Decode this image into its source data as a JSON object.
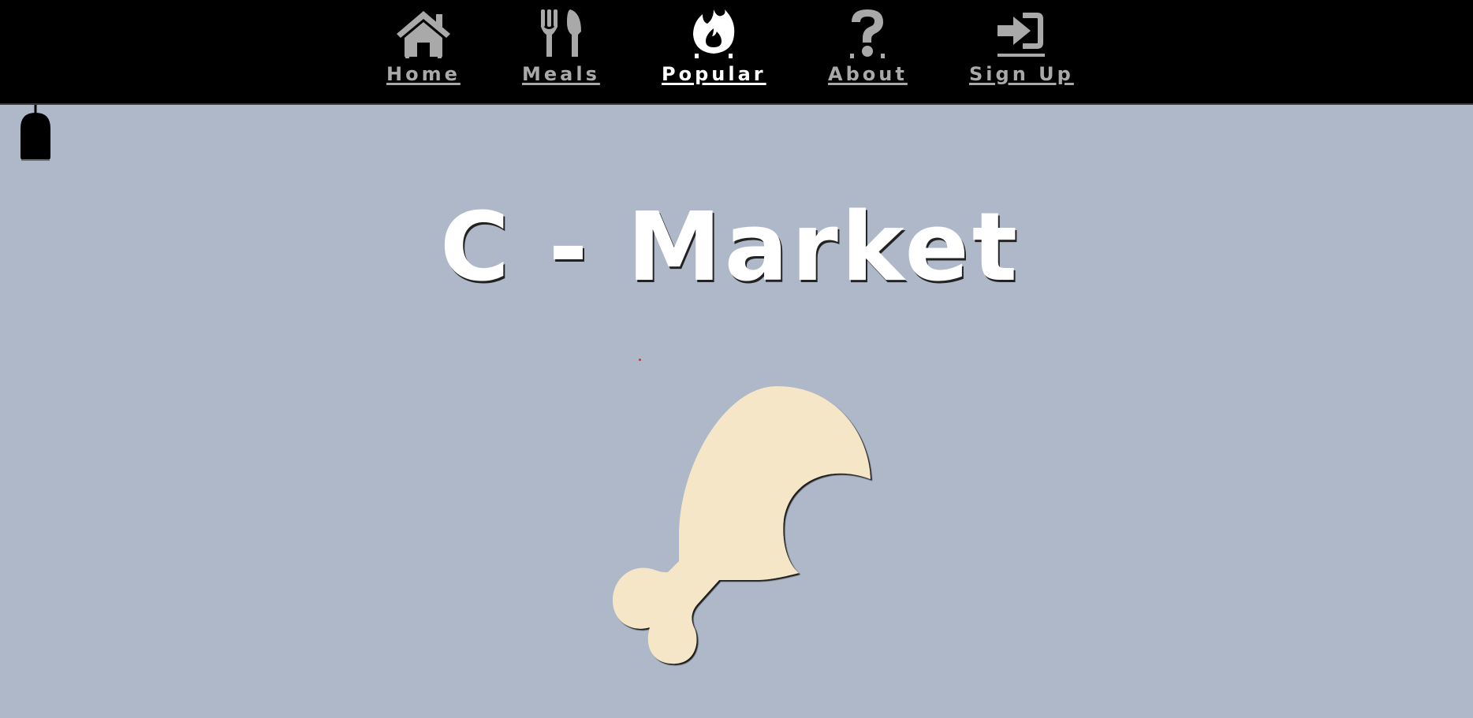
{
  "nav": {
    "items": [
      {
        "label": "Home",
        "icon": "home-icon",
        "active": false
      },
      {
        "label": "Meals",
        "icon": "utensils-icon",
        "active": false
      },
      {
        "label": "Popular",
        "icon": "fire-icon",
        "active": true
      },
      {
        "label": "About",
        "icon": "question-icon",
        "active": false
      },
      {
        "label": "Sign Up",
        "icon": "sign-in-icon",
        "active": false
      }
    ]
  },
  "hero": {
    "title": "C - Market",
    "image_icon": "drumstick-icon"
  },
  "colors": {
    "nav_background": "#000000",
    "nav_text": "#a9a9a9",
    "nav_active_text": "#ffffff",
    "page_background": "#aeb8c8",
    "title": "#ffffff",
    "drumstick_fill": "#f5e6c8"
  }
}
